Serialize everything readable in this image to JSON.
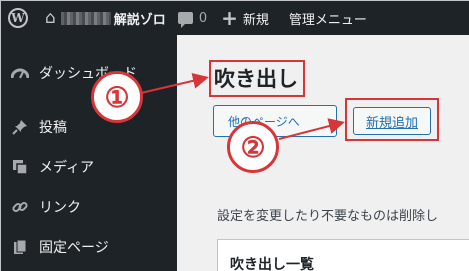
{
  "adminbar": {
    "site_name": "解説ゾロ",
    "comment_count": "0",
    "new_label": "新規",
    "manage_label": "管理メニュー"
  },
  "sidebar": {
    "items": [
      {
        "label": "ダッシュボード",
        "icon": "dashboard-icon"
      },
      {
        "label": "投稿",
        "icon": "pushpin-icon"
      },
      {
        "label": "メディア",
        "icon": "media-icon"
      },
      {
        "label": "リンク",
        "icon": "link-icon"
      },
      {
        "label": "固定ページ",
        "icon": "page-icon"
      }
    ]
  },
  "main": {
    "title": "吹き出し",
    "other_button": "他のページへ",
    "new_button": "新規追加",
    "description": "設定を変更したり不要なものは削除し",
    "panel_title": "吹き出し一覧"
  },
  "annotations": {
    "callout_1": "①",
    "callout_2": "②",
    "color": "#d63638"
  },
  "colors": {
    "adminbar_bg": "#1d2327",
    "accent": "#2271b1",
    "annotation": "#d63638"
  }
}
